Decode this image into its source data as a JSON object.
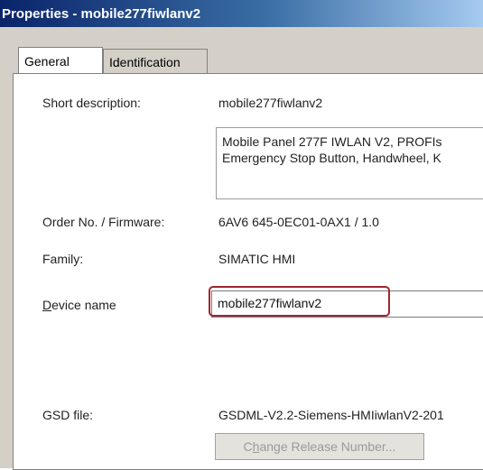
{
  "window": {
    "title": "Properties - mobile277fiwlanv2"
  },
  "tabs": [
    {
      "label": "General",
      "active": true
    },
    {
      "label": "Identification",
      "active": false
    }
  ],
  "fields": {
    "short_description": {
      "label": "Short description:",
      "value": "mobile277fiwlanv2"
    },
    "description_text": {
      "line1": "Mobile Panel 277F IWLAN V2, PROFIs",
      "line2": "Emergency Stop Button, Handwheel, K"
    },
    "order_no": {
      "label": "Order No. / Firmware:",
      "value": "6AV6 645-0EC01-0AX1 / 1.0"
    },
    "family": {
      "label": "Family:",
      "value": "SIMATIC HMI"
    },
    "device_name": {
      "label_first": "D",
      "label_rest": "evice name",
      "value": "mobile277fiwlanv2"
    },
    "gsd_file": {
      "label": "GSD file:",
      "value": "GSDML-V2.2-Siemens-HMIiwlanV2-201"
    }
  },
  "buttons": {
    "change_release": {
      "pre": "C",
      "mid": "h",
      "post": "ange Release Number..."
    }
  },
  "colors": {
    "highlight_border": "#a0262e",
    "titlebar_start": "#0a246a",
    "dialog_bg": "#d4d0c8"
  }
}
